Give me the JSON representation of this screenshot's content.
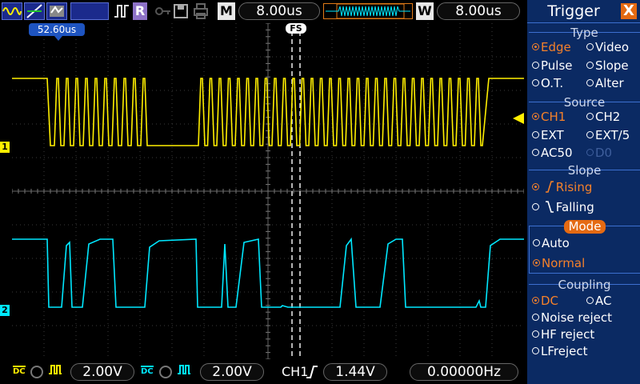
{
  "top_bar": {
    "mode_label": "M",
    "timebase": "8.00us",
    "window_mode_label": "W",
    "window_timebase": "8.00us",
    "icons": [
      "waveform-icon",
      "slash-icon",
      "gray-icon",
      "pulse-icon",
      "R-icon",
      "key-icon",
      "save-icon",
      "print-icon"
    ]
  },
  "plot": {
    "horizontal_position": "52.60us",
    "fs_label": "FS",
    "ch1_marker": "1",
    "ch2_marker": "2",
    "ch1_color": "#ffef00",
    "ch2_color": "#00e8ff"
  },
  "bottom_bar": {
    "ch1": {
      "coupling": "DC",
      "scale": "2.00V"
    },
    "ch2": {
      "coupling": "DC",
      "scale": "2.00V"
    },
    "trigger_source": "CH1",
    "trigger_level": "1.44V",
    "frequency": "0.00000Hz"
  },
  "side_panel": {
    "title": "Trigger",
    "close_label": "X",
    "type": {
      "title": "Type",
      "options": [
        {
          "label": "Edge",
          "selected": true
        },
        {
          "label": "Video",
          "selected": false
        },
        {
          "label": "Pulse",
          "selected": false
        },
        {
          "label": "Slope",
          "selected": false
        },
        {
          "label": "O.T.",
          "selected": false
        },
        {
          "label": "Alter",
          "selected": false
        }
      ]
    },
    "source": {
      "title": "Source",
      "options": [
        {
          "label": "CH1",
          "selected": true
        },
        {
          "label": "CH2",
          "selected": false
        },
        {
          "label": "EXT",
          "selected": false
        },
        {
          "label": "EXT/5",
          "selected": false
        },
        {
          "label": "AC50",
          "selected": false
        },
        {
          "label": "D0",
          "selected": false,
          "disabled": true
        }
      ]
    },
    "slope": {
      "title": "Slope",
      "options": [
        {
          "label": "Rising",
          "selected": true
        },
        {
          "label": "Falling",
          "selected": false
        }
      ]
    },
    "mode": {
      "title": "Mode",
      "options": [
        {
          "label": "Auto",
          "selected": false
        },
        {
          "label": "Normal",
          "selected": true
        }
      ]
    },
    "coupling": {
      "title": "Coupling",
      "options": [
        {
          "label": "DC",
          "selected": true
        },
        {
          "label": "AC",
          "selected": false
        },
        {
          "label": "Noise reject",
          "selected": false
        },
        {
          "label": "HF reject",
          "selected": false
        },
        {
          "label": "LFreject",
          "selected": false
        }
      ]
    }
  }
}
